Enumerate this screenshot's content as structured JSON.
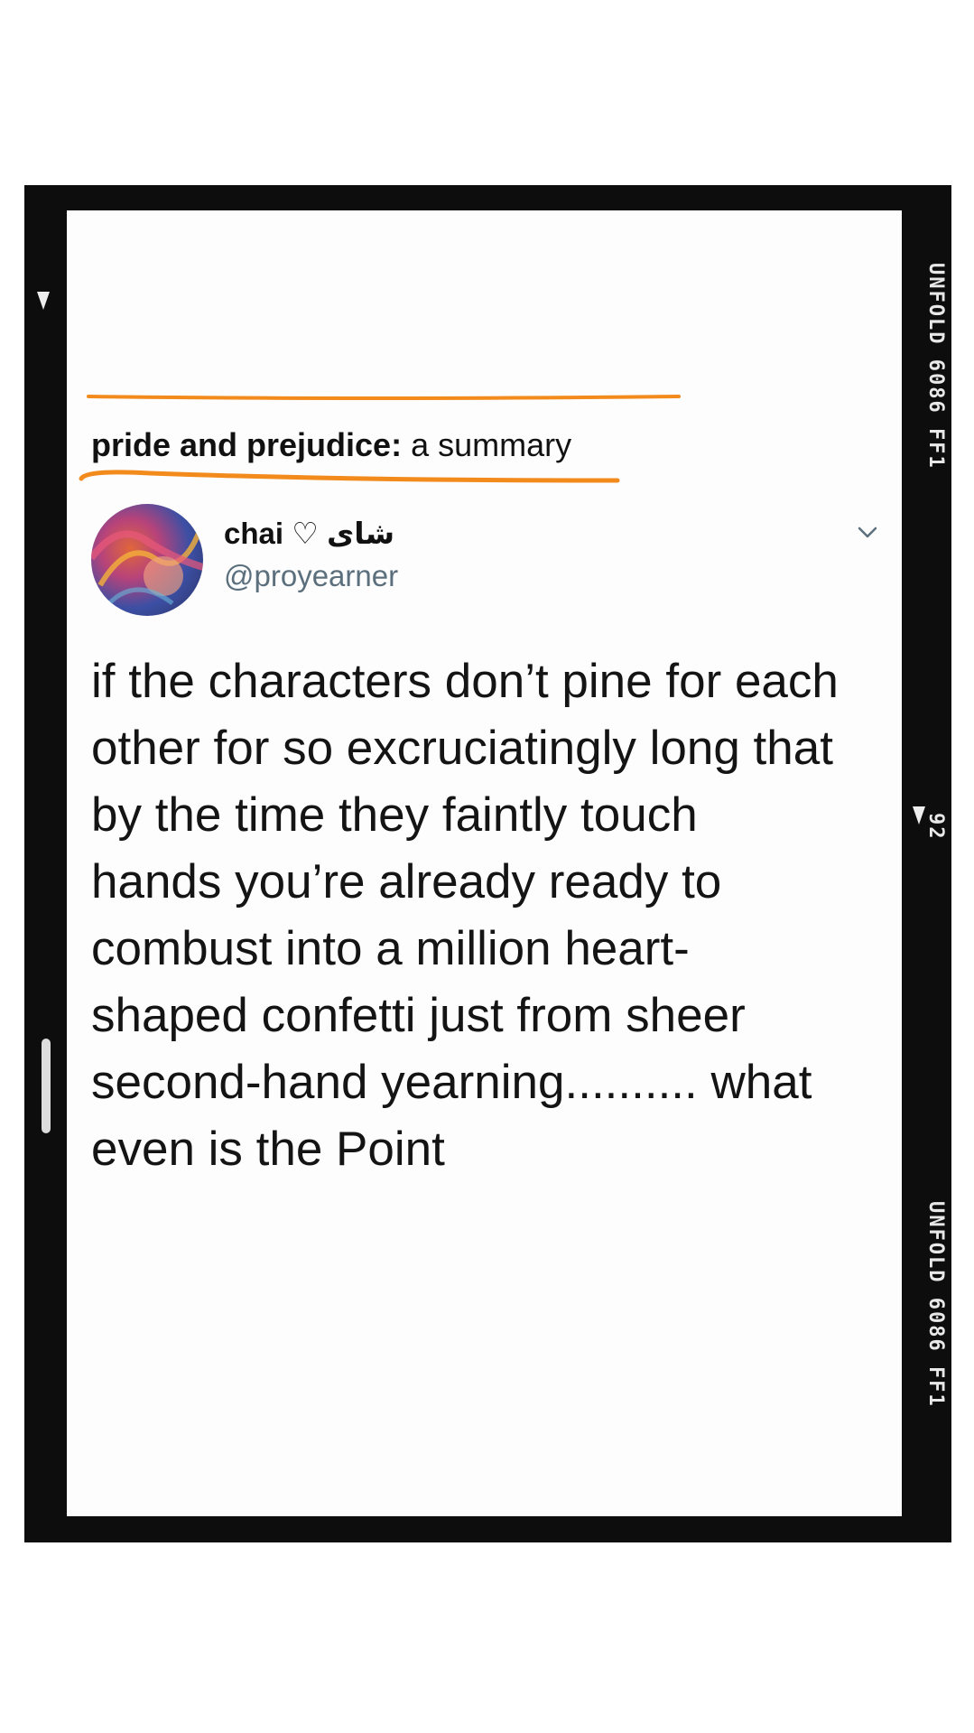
{
  "headline": {
    "bold": "pride and prejudice:",
    "rest": " a summary"
  },
  "tweet": {
    "display_name": "chai ♡ شاى",
    "handle": "@proyearner",
    "body_lines": [
      "if the characters don’t pine for each",
      "other for so excruciatingly long that",
      "by the time they faintly touch",
      "hands you’re already ready to",
      "combust into a million heart-",
      "shaped confetti just from sheer",
      "second-hand yearning.......... what",
      "even is the Point"
    ]
  },
  "film_edge": {
    "top": "UNFOLD 6086 FF1",
    "middle": "92",
    "bottom": "UNFOLD 6086 FF1"
  },
  "colors": {
    "highlight": "#f28a1c",
    "frame": "#0d0d0d",
    "handle": "#5b6f7d"
  },
  "icons": {
    "chevron": "chevron-down-icon"
  }
}
